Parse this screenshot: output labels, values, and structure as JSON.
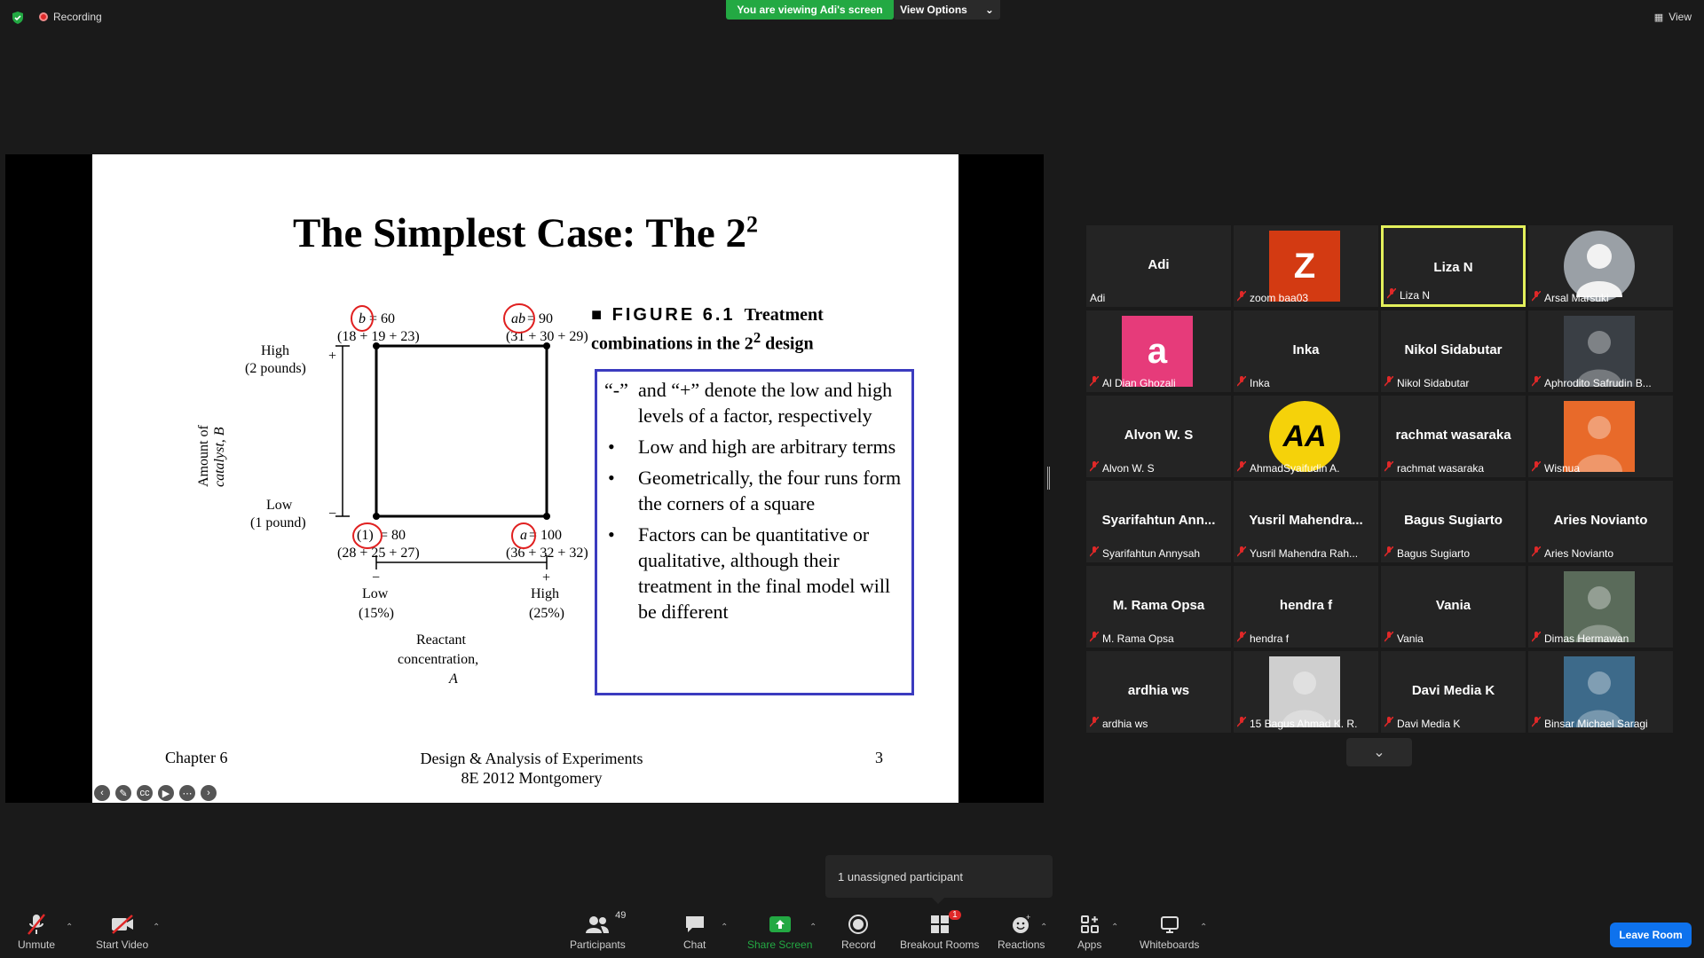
{
  "top_bar": {
    "recording_label": "Recording",
    "viewing_banner": "You are viewing Adi's screen",
    "view_options_label": "View Options",
    "view_label": "View"
  },
  "slide": {
    "title": "The Simplest Case: The 2",
    "title_sup": "2",
    "figure": {
      "b_label": "b",
      "b_value": " = 60",
      "b_sum": "(18 + 19 + 23)",
      "ab_label": "ab",
      "ab_value": " = 90",
      "ab_sum": "(31 + 30 + 29)",
      "one_label": "(1)",
      "one_value": " = 80",
      "one_sum": "(28 + 25 + 27)",
      "a_label": "a",
      "a_value": " = 100",
      "a_sum": "(36 + 32 + 32)",
      "high_b": "High",
      "high_b_sub": "(2 pounds)",
      "low_b": "Low",
      "low_b_sub": "(1 pound)",
      "plus": "+",
      "minus": "−",
      "y_axis_line1": "Amount of",
      "y_axis_line2": "catalyst, B",
      "low_a": "Low",
      "low_a_sub": "(15%)",
      "high_a": "High",
      "high_a_sub": "(25%)",
      "x_axis_line1": "Reactant",
      "x_axis_line2": "concentration,",
      "x_axis_line3": "A"
    },
    "caption_num": "■ FIGURE 6.1",
    "caption_text1": "Treatment",
    "caption_text2": "combinations in the 2",
    "caption_sup": "2",
    "caption_text3": " design",
    "bullets": [
      {
        "mark": "“-”",
        "text": "and “+” denote the low and high levels of a factor, respectively"
      },
      {
        "mark": "•",
        "text": "Low and high are arbitrary terms"
      },
      {
        "mark": "•",
        "text": "Geometrically, the four runs form the corners of a square"
      },
      {
        "mark": "•",
        "text": "Factors can be quantitative or qualitative, although their treatment in the final model will be different"
      }
    ],
    "footer_left": "Chapter 6",
    "footer_center_1": "Design & Analysis of Experiments",
    "footer_center_2": "8E 2012 Montgomery",
    "footer_right": "3"
  },
  "participants": [
    {
      "name": "Adi",
      "label": "Adi",
      "muted": false,
      "avatar": "",
      "avatar_color": ""
    },
    {
      "name": "",
      "label": "zoom baa03",
      "muted": true,
      "avatar": "Z",
      "avatar_color": "#d33a12"
    },
    {
      "name": "Liza N",
      "label": "Liza N",
      "muted": true,
      "avatar": "",
      "avatar_color": "",
      "active": true
    },
    {
      "name": "",
      "label": "Arsal Marsuki",
      "muted": true,
      "avatar": "person",
      "avatar_color": "#9aa0a6"
    },
    {
      "name": "",
      "label": "Al Dian Ghozali",
      "muted": true,
      "avatar": "a",
      "avatar_color": "#e63b7a"
    },
    {
      "name": "Inka",
      "label": "Inka",
      "muted": true,
      "avatar": "",
      "avatar_color": ""
    },
    {
      "name": "Nikol Sidabutar",
      "label": "Nikol Sidabutar",
      "muted": true,
      "avatar": "",
      "avatar_color": ""
    },
    {
      "name": "",
      "label": "Aphrodito Safrudin B...",
      "muted": true,
      "avatar": "photo",
      "avatar_color": "#3a3f45"
    },
    {
      "name": "Alvon W. S",
      "label": "Alvon W. S",
      "muted": true,
      "avatar": "",
      "avatar_color": ""
    },
    {
      "name": "",
      "label": "AhmadSyaifudin A.",
      "muted": true,
      "avatar": "AA",
      "avatar_color": "#f5d20a"
    },
    {
      "name": "rachmat wasaraka",
      "label": "rachmat wasaraka",
      "muted": true,
      "avatar": "",
      "avatar_color": ""
    },
    {
      "name": "",
      "label": "Wisnua",
      "muted": true,
      "avatar": "photo",
      "avatar_color": "#e86a2a"
    },
    {
      "name": "Syarifahtun Ann...",
      "label": "Syarifahtun Annysah",
      "muted": true,
      "avatar": "",
      "avatar_color": ""
    },
    {
      "name": "Yusril Mahendra...",
      "label": "Yusril Mahendra Rah...",
      "muted": true,
      "avatar": "",
      "avatar_color": ""
    },
    {
      "name": "Bagus Sugiarto",
      "label": "Bagus Sugiarto",
      "muted": true,
      "avatar": "",
      "avatar_color": ""
    },
    {
      "name": "Aries Novianto",
      "label": "Aries Novianto",
      "muted": true,
      "avatar": "",
      "avatar_color": ""
    },
    {
      "name": "M. Rama Opsa",
      "label": "M. Rama Opsa",
      "muted": true,
      "avatar": "",
      "avatar_color": ""
    },
    {
      "name": "hendra f",
      "label": "hendra f",
      "muted": true,
      "avatar": "",
      "avatar_color": ""
    },
    {
      "name": "Vania",
      "label": "Vania",
      "muted": true,
      "avatar": "",
      "avatar_color": ""
    },
    {
      "name": "",
      "label": "Dimas Hermawan",
      "muted": true,
      "avatar": "photo",
      "avatar_color": "#5a6b5a"
    },
    {
      "name": "ardhia ws",
      "label": "ardhia ws",
      "muted": true,
      "avatar": "",
      "avatar_color": ""
    },
    {
      "name": "",
      "label": "15 Bagus Ahmad K. R.",
      "muted": true,
      "avatar": "photo",
      "avatar_color": "#cfcfcf"
    },
    {
      "name": "Davi Media K",
      "label": "Davi Media K",
      "muted": true,
      "avatar": "",
      "avatar_color": ""
    },
    {
      "name": "",
      "label": "Binsar Michael Saragi",
      "muted": true,
      "avatar": "photo",
      "avatar_color": "#3d6a8a"
    }
  ],
  "tooltip": "1 unassigned participant",
  "toolbar": {
    "unmute": "Unmute",
    "start_video": "Start Video",
    "participants": "Participants",
    "participants_count": "49",
    "chat": "Chat",
    "share_screen": "Share Screen",
    "record": "Record",
    "breakout_rooms": "Breakout Rooms",
    "breakout_badge": "1",
    "reactions": "Reactions",
    "apps": "Apps",
    "whiteboards": "Whiteboards",
    "leave_room": "Leave Room"
  },
  "colors": {
    "accent_green": "#23a943",
    "leave_blue": "#0e72ed",
    "active_border": "#e3f05b",
    "muted_red": "#e02828"
  }
}
